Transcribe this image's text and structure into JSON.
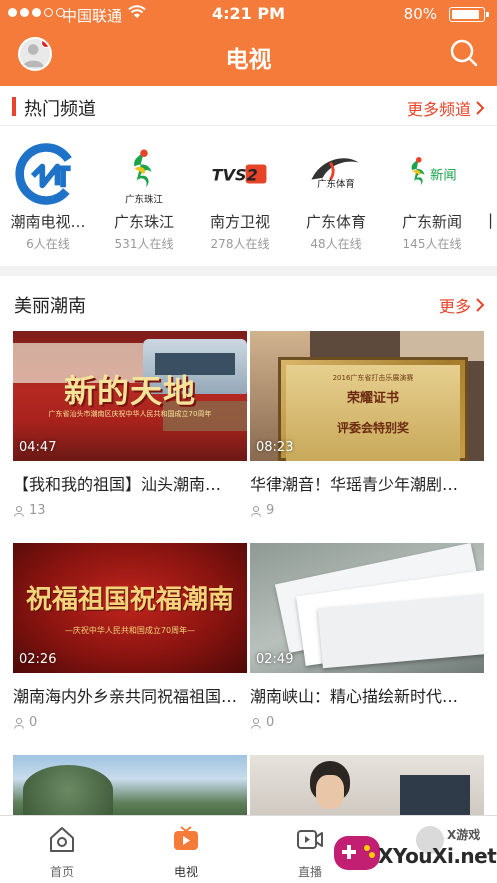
{
  "status_bar": {
    "carrier": "中国联通",
    "time": "4:21 PM",
    "battery": "80%"
  },
  "header": {
    "title": "电视"
  },
  "hot_channels": {
    "title": "热门频道",
    "more_label": "更多频道",
    "items": [
      {
        "name": "潮南电视…",
        "count": "6人在线",
        "logo": "chaonan-tv-logo"
      },
      {
        "name": "广东珠江",
        "count": "531人在线",
        "logo": "gd-zhujiang-logo",
        "logo_text": "广东珠江"
      },
      {
        "name": "南方卫视",
        "count": "278人在线",
        "logo": "tvs2-logo",
        "logo_text": "TVS2"
      },
      {
        "name": "广东体育",
        "count": "48人在线",
        "logo": "gd-sports-logo",
        "logo_text": "广东体育"
      },
      {
        "name": "广东新闻",
        "count": "145人在线",
        "logo": "gd-news-logo",
        "logo_text": "新闻"
      }
    ]
  },
  "beautiful_chaonan": {
    "title": "美丽潮南",
    "more_label": "更多",
    "videos": [
      {
        "title": "【我和我的祖国】汕头潮南…",
        "duration": "04:47",
        "views": "13",
        "thumb_text": "新的天地",
        "thumb_sub": "广东省汕头市潮南区庆祝中华人民共和国成立70周年"
      },
      {
        "title": "华律潮音！华瑶青少年潮剧…",
        "duration": "08:23",
        "views": "9",
        "thumb_text": "荣耀证书",
        "thumb_sub": "2016广东省打击乐展演赛",
        "thumb_sub2": "评委会特别奖"
      },
      {
        "title": "潮南海内外乡亲共同祝福祖国…",
        "duration": "02:26",
        "views": "0",
        "thumb_text": "祝福祖国祝福潮南",
        "thumb_sub": "—庆祝中华人民共和国成立70周年—"
      },
      {
        "title": "潮南峡山：精心描绘新时代…",
        "duration": "02:49",
        "views": "0",
        "thumb_text": ""
      }
    ]
  },
  "tabbar": {
    "items": [
      {
        "label": "首页",
        "icon": "home-icon"
      },
      {
        "label": "电视",
        "icon": "tv-icon",
        "active": true
      },
      {
        "label": "直播",
        "icon": "live-icon"
      }
    ]
  },
  "watermark": {
    "brand": "XYouXi.net",
    "tag": "X游戏"
  },
  "colors": {
    "brand": "#f47b3a",
    "accent_red": "#e8442a",
    "muted": "#999999"
  }
}
